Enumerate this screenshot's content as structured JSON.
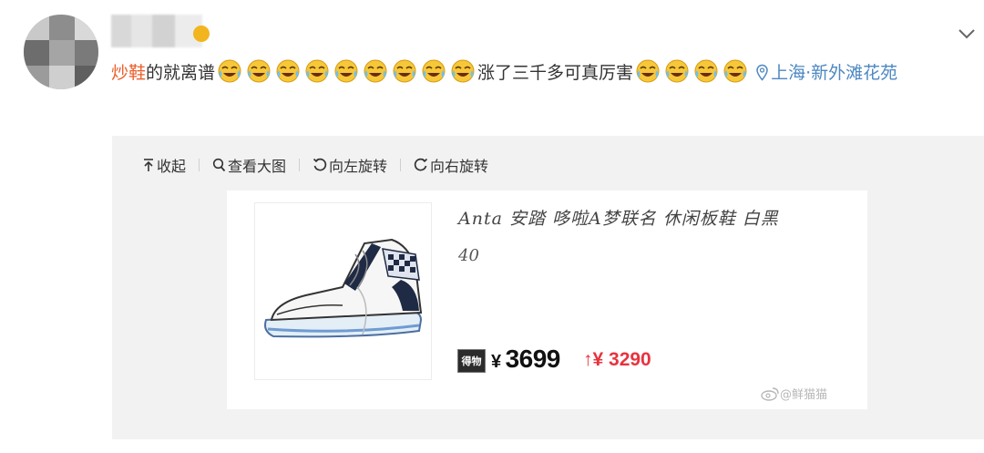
{
  "post": {
    "highlight": "炒鞋",
    "text_before_emojis": "的就离谱",
    "text_middle": "涨了三千多可真厉害",
    "location": "上海·新外滩花苑",
    "emoji_name": "laugh-cry-icon",
    "emoji_count_first": 9,
    "emoji_count_second": 4
  },
  "toolbar": {
    "collapse_label": "收起",
    "view_large_label": "查看大图",
    "rotate_left_label": "向左旋转",
    "rotate_right_label": "向右旋转"
  },
  "product": {
    "title": "Anta 安踏 哆啦A梦联名 休闲板鞋 白黑",
    "size": "40",
    "badge": "得物",
    "currency": "¥",
    "price": "3699",
    "rise_arrow": "↑",
    "rise_amount": "¥ 3290",
    "image_icon": "sneaker-image"
  },
  "watermark": {
    "text": "@鲜猫猫"
  },
  "colors": {
    "highlight": "#eb5e2a",
    "location": "#4e88c2",
    "rise": "#e8333f",
    "panel_bg": "#f2f2f2"
  }
}
